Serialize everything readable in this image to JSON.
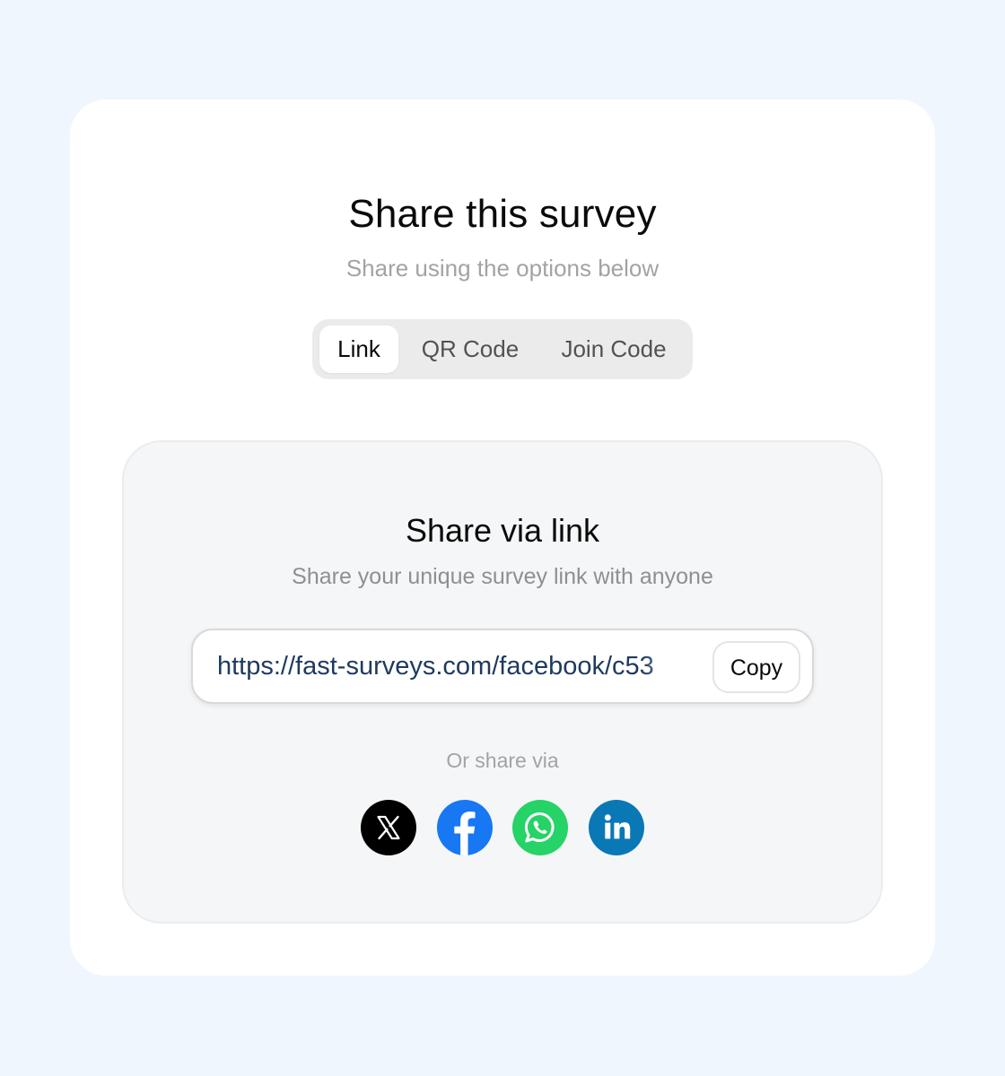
{
  "dialog": {
    "title": "Share this survey",
    "subtitle": "Share using the options below"
  },
  "tabs": [
    {
      "label": "Link",
      "active": true
    },
    {
      "label": "QR Code",
      "active": false
    },
    {
      "label": "Join Code",
      "active": false
    }
  ],
  "link_panel": {
    "title": "Share via link",
    "subtitle": "Share your unique survey link with anyone",
    "url": "https://fast-surveys.com/facebook/c53",
    "copy_label": "Copy",
    "or_share_label": "Or share via"
  },
  "social": [
    {
      "name": "x",
      "icon": "x-icon",
      "color": "#000000"
    },
    {
      "name": "facebook",
      "icon": "facebook-icon",
      "color": "#1877f2"
    },
    {
      "name": "whatsapp",
      "icon": "whatsapp-icon",
      "color": "#25d366"
    },
    {
      "name": "linkedin",
      "icon": "linkedin-icon",
      "color": "#0a78b5"
    }
  ]
}
